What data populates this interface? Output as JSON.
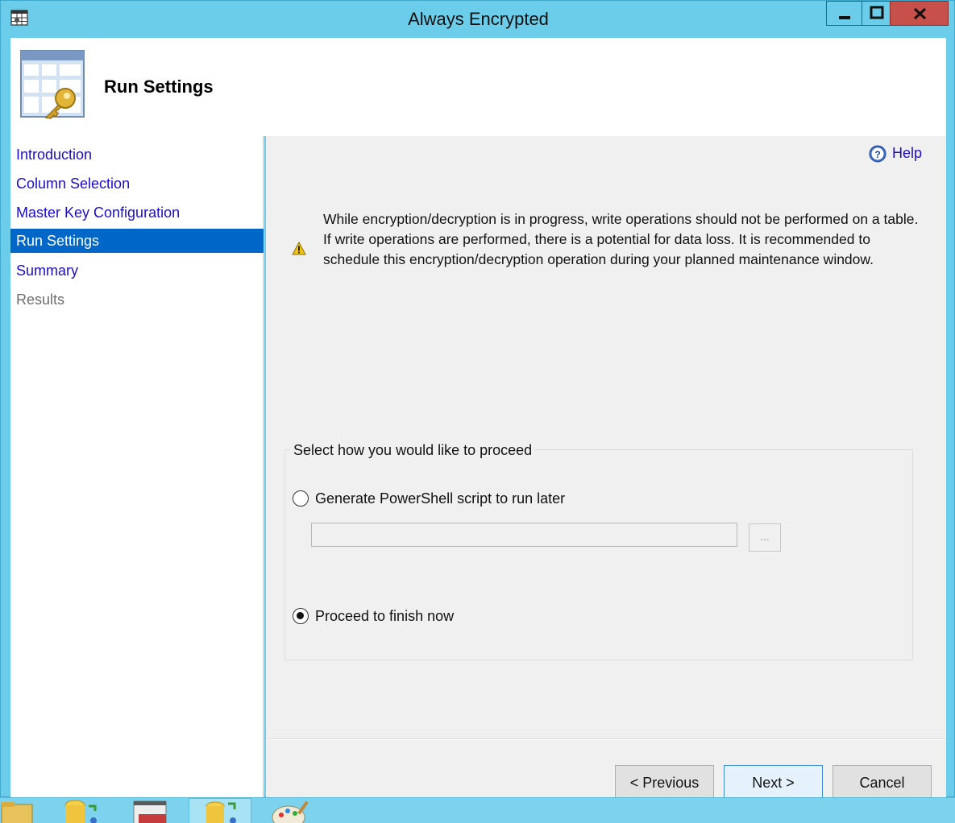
{
  "window": {
    "title": "Always Encrypted"
  },
  "header": {
    "title": "Run Settings"
  },
  "sidebar": {
    "items": [
      {
        "label": "Introduction",
        "state": "link"
      },
      {
        "label": "Column Selection",
        "state": "link"
      },
      {
        "label": "Master Key Configuration",
        "state": "link"
      },
      {
        "label": "Run Settings",
        "state": "active"
      },
      {
        "label": "Summary",
        "state": "link"
      },
      {
        "label": "Results",
        "state": "disabled"
      }
    ]
  },
  "main": {
    "help_label": "Help",
    "warning_text": "While encryption/decryption is in progress, write operations should not be performed on a table. If write operations are performed, there is a potential for data loss. It is recommended to schedule this encryption/decryption operation during your planned maintenance window.",
    "group_label": "Select how you would like to proceed",
    "options": [
      {
        "label": "Generate PowerShell script to run later",
        "selected": false
      },
      {
        "label": "Proceed to finish now",
        "selected": true
      }
    ],
    "script_path": {
      "value": "",
      "placeholder": ""
    },
    "browse_label": "..."
  },
  "footer": {
    "previous_label": "< Previous",
    "next_label": "Next >",
    "cancel_label": "Cancel"
  },
  "colors": {
    "accent": "#0067c9",
    "link": "#1a0dcc",
    "title_bar": "#6ccdeb",
    "close_button": "#c7504a"
  },
  "icons": {
    "app": "table-app-icon",
    "header": "table-key-icon",
    "help": "help-icon",
    "warning": "warning-icon"
  }
}
